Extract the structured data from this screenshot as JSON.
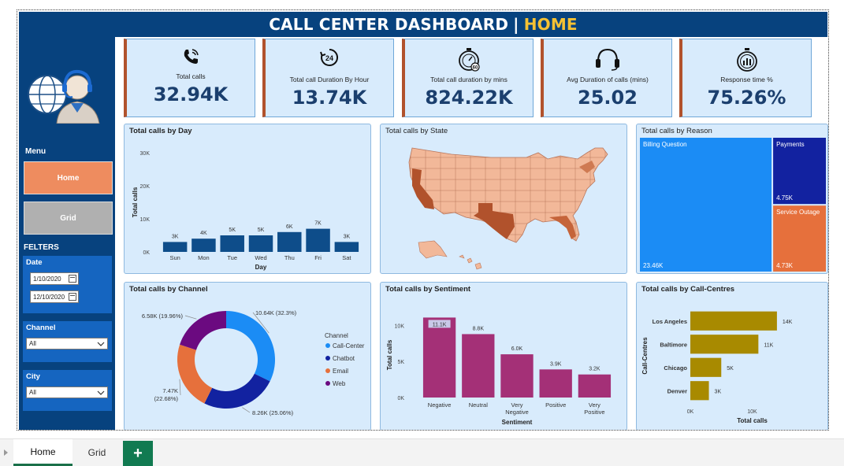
{
  "title": {
    "main": "CALL CENTER DASHBOARD",
    "sep": "|",
    "page": "HOME"
  },
  "colors": {
    "navy": "#07427e",
    "accent": "#f5c133",
    "bar_blue": "#0e4d8a",
    "sentiment": "#a43077",
    "centres": "#a88a00",
    "kpi_border": "#b1522c"
  },
  "sidebar": {
    "avatar_icon": "call-agent-globe-icon",
    "menu_label": "Menu",
    "home_label": "Home",
    "grid_label": "Grid",
    "filters_label": "FELTERS",
    "date": {
      "label": "Date",
      "start": "1/10/2020",
      "end": "12/10/2020"
    },
    "channel": {
      "label": "Channel",
      "value": "All"
    },
    "city": {
      "label": "City",
      "value": "All"
    }
  },
  "kpis": [
    {
      "icon": "phone-icon",
      "label": "Total calls",
      "value": "32.94K"
    },
    {
      "icon": "clock-24-icon",
      "label": "Total call Duration By Hour",
      "value": "13.74K"
    },
    {
      "icon": "stopwatch-60-icon",
      "label": "Total call duration by mins",
      "value": "824.22K"
    },
    {
      "icon": "headset-icon",
      "label": "Avg Duration of calls (mins)",
      "value": "25.02"
    },
    {
      "icon": "timer-bars-icon",
      "label": "Response time %",
      "value": "75.26%"
    }
  ],
  "chart_data": [
    {
      "id": "by_day",
      "type": "bar",
      "title": "Total calls by Day",
      "xlabel": "Day",
      "ylabel": "Total calls",
      "categories": [
        "Sun",
        "Mon",
        "Tue",
        "Wed",
        "Thu",
        "Fri",
        "Sat"
      ],
      "values": [
        3000,
        4000,
        5000,
        5000,
        6000,
        7000,
        3000
      ],
      "labels": [
        "3K",
        "4K",
        "5K",
        "5K",
        "6K",
        "7K",
        "3K"
      ],
      "yticks": [
        "0K",
        "10K",
        "20K",
        "30K"
      ],
      "ylim": [
        0,
        30000
      ],
      "color": "#0e4d8a"
    },
    {
      "id": "by_state",
      "type": "map",
      "title": "Total calls by State"
    },
    {
      "id": "by_reason",
      "type": "treemap",
      "title": "Total calls by Reason",
      "items": [
        {
          "name": "Billing Question",
          "value": 23460,
          "label": "23.46K",
          "color": "#1b8cf5"
        },
        {
          "name": "Payments",
          "value": 4750,
          "label": "4.75K",
          "color": "#1222a0"
        },
        {
          "name": "Service Outage",
          "value": 4730,
          "label": "4.73K",
          "color": "#e6703c"
        }
      ]
    },
    {
      "id": "by_channel",
      "type": "pie",
      "title": "Total calls by Channel",
      "legend_title": "Channel",
      "items": [
        {
          "name": "Call-Center",
          "value": 10640,
          "label": "10.64K (32.3%)",
          "color": "#1b8cf5"
        },
        {
          "name": "Chatbot",
          "value": 8260,
          "label": "8.26K (25.06%)",
          "color": "#1222a0"
        },
        {
          "name": "Email",
          "value": 7470,
          "label": "7.47K (22.68%)",
          "color": "#e6703c"
        },
        {
          "name": "Web",
          "value": 6580,
          "label": "6.58K (19.96%)",
          "color": "#6b0a80"
        }
      ]
    },
    {
      "id": "by_sentiment",
      "type": "bar",
      "title": "Total calls by Sentiment",
      "xlabel": "Sentiment",
      "ylabel": "Total calls",
      "categories": [
        "Negative",
        "Neutral",
        "Very Negative",
        "Positive",
        "Very Positive"
      ],
      "values": [
        11100,
        8800,
        6000,
        3900,
        3200
      ],
      "labels": [
        "11.1K",
        "8.8K",
        "6.0K",
        "3.9K",
        "3.2K"
      ],
      "yticks": [
        "0K",
        "5K",
        "10K"
      ],
      "ylim": [
        0,
        11800
      ],
      "color": "#a43077"
    },
    {
      "id": "by_centre",
      "type": "bar",
      "orientation": "horizontal",
      "title": "Total calls by Call-Centres",
      "xlabel": "Total calls",
      "ylabel": "Call-Centres",
      "categories": [
        "Los Angeles",
        "Baltimore",
        "Chicago",
        "Denver"
      ],
      "values": [
        14000,
        11000,
        5000,
        3000
      ],
      "labels": [
        "14K",
        "11K",
        "5K",
        "3K"
      ],
      "xticks": [
        "0K",
        "10K"
      ],
      "xlim": [
        0,
        20000
      ],
      "color": "#a88a00"
    }
  ],
  "tabs": {
    "home": "Home",
    "grid": "Grid",
    "add": "+"
  }
}
